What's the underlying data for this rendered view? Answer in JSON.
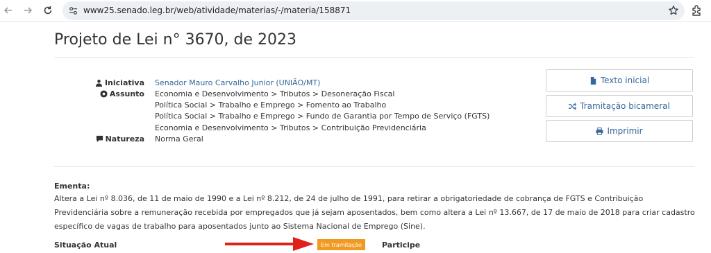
{
  "browser": {
    "url": "www25.senado.leg.br/web/atividade/materias/-/materia/158871"
  },
  "page": {
    "title": "Projeto de Lei n° 3670, de 2023"
  },
  "meta": {
    "iniciativa_label": "Iniciativa",
    "iniciativa_value": "Senador Mauro Carvalho Junior (UNIÃO/MT)",
    "assunto_label": "Assunto",
    "assunto_values": [
      "Economia e Desenvolvimento > Tributos > Desoneração Fiscal",
      "Política Social > Trabalho e Emprego > Fomento ao Trabalho",
      "Política Social > Trabalho e Emprego > Fundo de Garantia por Tempo de Serviço (FGTS)",
      "Economia e Desenvolvimento > Tributos > Contribuição Previdenciária"
    ],
    "natureza_label": "Natureza",
    "natureza_value": "Norma Geral"
  },
  "actions": {
    "texto_inicial": "Texto inicial",
    "tramitacao": "Tramitação bicameral",
    "imprimir": "Imprimir"
  },
  "ementa": {
    "label": "Ementa:",
    "lines": [
      "Altera a Lei nº 8.036, de 11 de maio de 1990 e a Lei nº 8.212, de 24 de julho de 1991, para retirar a obrigatoriedade de cobrança de FGTS e Contribuição",
      "Previdenciária sobre a remuneração recebida por empregados que já sejam aposentados, bem como altera a Lei nº 13.667, de 17 de maio de 2018 para criar cadastro",
      "específico de vagas de trabalho para aposentados junto ao Sistema Nacional de Emprego (Sine)."
    ]
  },
  "situacao": {
    "label": "Situação Atual",
    "badge": "Em tramitação",
    "participe": "Participe"
  },
  "colors": {
    "link": "#34679a",
    "badge": "#f09a22",
    "arrow": "#e0201b"
  },
  "icons": [
    "back-arrow-icon",
    "forward-arrow-icon",
    "reload-icon",
    "site-settings-icon",
    "bookmark-star-icon",
    "extensions-icon",
    "user-icon",
    "circle-dot-icon",
    "comment-icon",
    "file-icon",
    "shuffle-icon",
    "print-icon"
  ]
}
